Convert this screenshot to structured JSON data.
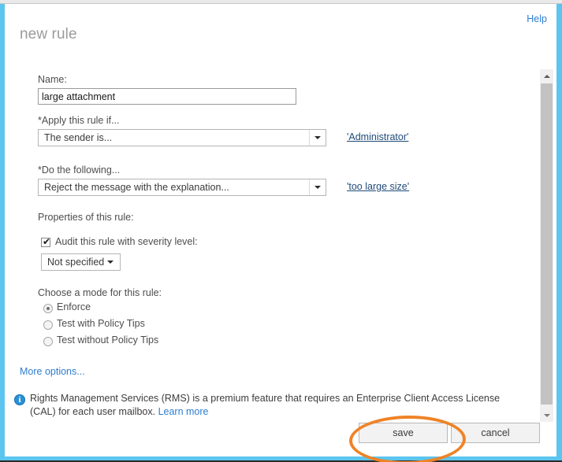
{
  "window": {
    "frame_color": "#5bc5ef",
    "dialog_background": "#ffffff"
  },
  "header": {
    "title": "new rule",
    "help_label": "Help"
  },
  "form": {
    "name": {
      "label": "Name:",
      "value": "large attachment",
      "placeholder": ""
    },
    "condition": {
      "label": "*Apply this rule if...",
      "selected": "The sender is...",
      "link": "'Administrator'"
    },
    "action": {
      "label": "*Do the following...",
      "selected": "Reject the message with the explanation...",
      "link": "'too large size'"
    },
    "properties": {
      "label": "Properties of this rule:",
      "audit": {
        "label": "Audit this rule with severity level:",
        "checked": true,
        "severity_selected": "Not specified"
      }
    },
    "mode": {
      "label": "Choose a mode for this rule:",
      "options": [
        {
          "label": "Enforce",
          "selected": true
        },
        {
          "label": "Test with Policy Tips",
          "selected": false
        },
        {
          "label": "Test without Policy Tips",
          "selected": false
        }
      ]
    },
    "more_options_label": "More options..."
  },
  "notice": {
    "icon": "info-icon",
    "text": "Rights Management Services (RMS) is a premium feature that requires an Enterprise Client Access License (CAL) for each user mailbox. ",
    "link_label": "Learn more"
  },
  "footer": {
    "save_label": "save",
    "cancel_label": "cancel"
  },
  "annotation": {
    "shape": "ellipse",
    "color": "#ef8327",
    "targets": "save-button"
  },
  "scrollbar": {
    "up_icon": "caret-up-icon",
    "down_icon": "caret-down-icon"
  }
}
